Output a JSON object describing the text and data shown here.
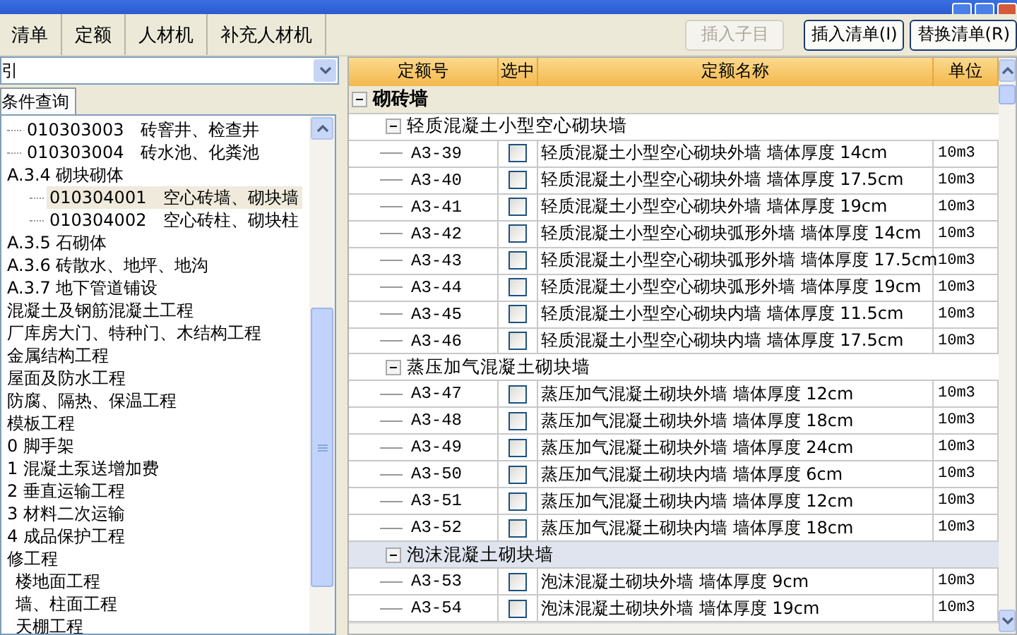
{
  "tabs": [
    {
      "label": "清单",
      "selected": false
    },
    {
      "label": "定额",
      "selected": false
    },
    {
      "label": "人材机",
      "selected": false
    },
    {
      "label": "补充人材机",
      "selected": false
    }
  ],
  "actions": [
    {
      "label": "插入子目",
      "disabled": true
    },
    {
      "label": "插入清单(I)",
      "disabled": false
    },
    {
      "label": "替换清单(R)",
      "disabled": false
    }
  ],
  "index_dropdown": {
    "value": "引"
  },
  "query_tab": {
    "label": "条件查询"
  },
  "tree": [
    {
      "label": "010303003　砖窨井、检查井",
      "kind": "leaf",
      "selected": false
    },
    {
      "label": "010303004　砖水池、化粪池",
      "kind": "leaf",
      "selected": false
    },
    {
      "label": "A.3.4 砌块砌体",
      "kind": "node",
      "selected": false,
      "children": [
        {
          "label": "010304001　空心砖墙、砌块墙",
          "kind": "leaf",
          "selected": true
        },
        {
          "label": "010304002　空心砖柱、砌块柱",
          "kind": "leaf",
          "selected": false
        }
      ]
    },
    {
      "label": "A.3.5 石砌体",
      "kind": "node",
      "selected": false
    },
    {
      "label": "A.3.6 砖散水、地坪、地沟",
      "kind": "node",
      "selected": false
    },
    {
      "label": "A.3.7 地下管道铺设",
      "kind": "node",
      "selected": false
    },
    {
      "label": "混凝土及钢筋混凝土工程",
      "kind": "node",
      "selected": false
    },
    {
      "label": "厂库房大门、特种门、木结构工程",
      "kind": "node",
      "selected": false
    },
    {
      "label": "金属结构工程",
      "kind": "node",
      "selected": false
    },
    {
      "label": "屋面及防水工程",
      "kind": "node",
      "selected": false
    },
    {
      "label": "防腐、隔热、保温工程",
      "kind": "node",
      "selected": false
    },
    {
      "label": "模板工程",
      "kind": "node",
      "selected": false
    },
    {
      "label": "0 脚手架",
      "kind": "node",
      "selected": false
    },
    {
      "label": "1 混凝土泵送增加费",
      "kind": "node",
      "selected": false
    },
    {
      "label": "2 垂直运输工程",
      "kind": "node",
      "selected": false
    },
    {
      "label": "3 材料二次运输",
      "kind": "node",
      "selected": false
    },
    {
      "label": "4 成品保护工程",
      "kind": "node",
      "selected": false
    },
    {
      "label": "修工程",
      "kind": "node",
      "selected": false,
      "children": [
        {
          "label": "楼地面工程",
          "kind": "node",
          "selected": false
        },
        {
          "label": "墙、柱面工程",
          "kind": "node",
          "selected": false
        },
        {
          "label": "天棚工程",
          "kind": "node",
          "selected": false
        }
      ]
    }
  ],
  "grid": {
    "columns": [
      "定额号",
      "选中",
      "定额名称",
      "单位"
    ],
    "sections": [
      {
        "title": "砌砖墙",
        "expanded": true,
        "groups": [
          {
            "title": "轻质混凝土小型空心砌块墙",
            "expanded": true,
            "selected": false,
            "rows": [
              {
                "code": "A3-39",
                "checked": false,
                "name": "轻质混凝土小型空心砌块外墙 墙体厚度 14cm",
                "unit": "10m3"
              },
              {
                "code": "A3-40",
                "checked": false,
                "name": "轻质混凝土小型空心砌块外墙 墙体厚度 17.5cm",
                "unit": "10m3"
              },
              {
                "code": "A3-41",
                "checked": false,
                "name": "轻质混凝土小型空心砌块外墙 墙体厚度 19cm",
                "unit": "10m3"
              },
              {
                "code": "A3-42",
                "checked": false,
                "name": "轻质混凝土小型空心砌块弧形外墙 墙体厚度 14cm",
                "unit": "10m3"
              },
              {
                "code": "A3-43",
                "checked": false,
                "name": "轻质混凝土小型空心砌块弧形外墙 墙体厚度 17.5cm",
                "unit": "10m3"
              },
              {
                "code": "A3-44",
                "checked": false,
                "name": "轻质混凝土小型空心砌块弧形外墙 墙体厚度 19cm",
                "unit": "10m3"
              },
              {
                "code": "A3-45",
                "checked": false,
                "name": "轻质混凝土小型空心砌块内墙 墙体厚度 11.5cm",
                "unit": "10m3"
              },
              {
                "code": "A3-46",
                "checked": false,
                "name": "轻质混凝土小型空心砌块内墙 墙体厚度 17.5cm",
                "unit": "10m3"
              }
            ]
          },
          {
            "title": "蒸压加气混凝土砌块墙",
            "expanded": true,
            "selected": false,
            "rows": [
              {
                "code": "A3-47",
                "checked": false,
                "name": "蒸压加气混凝土砌块外墙 墙体厚度 12cm",
                "unit": "10m3"
              },
              {
                "code": "A3-48",
                "checked": false,
                "name": "蒸压加气混凝土砌块外墙 墙体厚度 18cm",
                "unit": "10m3"
              },
              {
                "code": "A3-49",
                "checked": false,
                "name": "蒸压加气混凝土砌块外墙 墙体厚度 24cm",
                "unit": "10m3"
              },
              {
                "code": "A3-50",
                "checked": false,
                "name": "蒸压加气混凝土砌块内墙 墙体厚度 6cm",
                "unit": "10m3"
              },
              {
                "code": "A3-51",
                "checked": false,
                "name": "蒸压加气混凝土砌块内墙 墙体厚度 12cm",
                "unit": "10m3"
              },
              {
                "code": "A3-52",
                "checked": false,
                "name": "蒸压加气混凝土砌块内墙 墙体厚度 18cm",
                "unit": "10m3"
              }
            ]
          },
          {
            "title": "泡沫混凝土砌块墙",
            "expanded": true,
            "selected": true,
            "rows": [
              {
                "code": "A3-53",
                "checked": false,
                "name": "泡沫混凝土砌块外墙 墙体厚度 9cm",
                "unit": "10m3"
              },
              {
                "code": "A3-54",
                "checked": false,
                "name": "泡沫混凝土砌块外墙 墙体厚度 19cm",
                "unit": "10m3"
              }
            ]
          }
        ]
      }
    ]
  }
}
